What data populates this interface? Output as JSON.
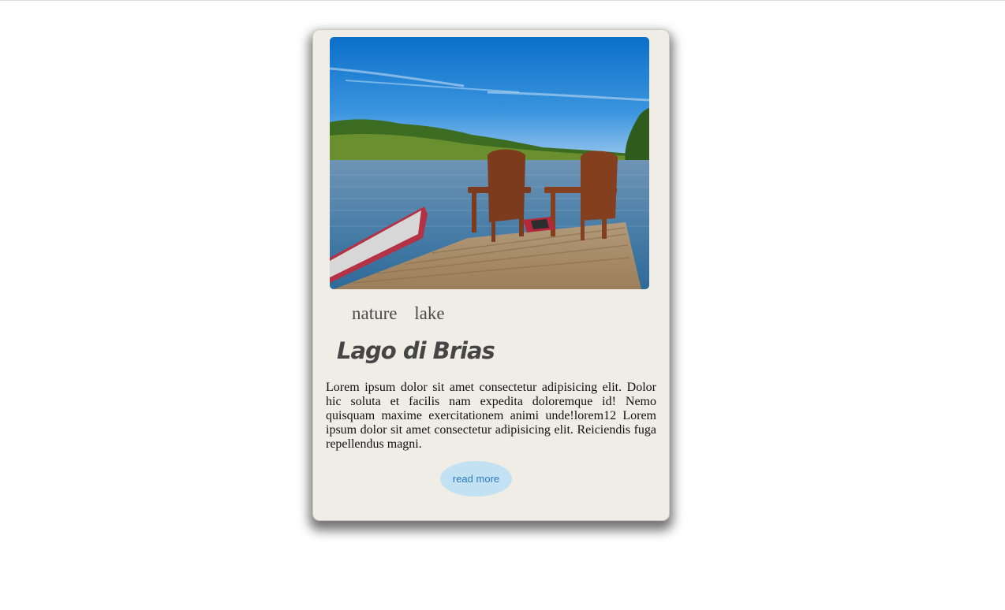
{
  "card": {
    "image_alt": "Two wooden Adirondack chairs on a dock by a lake with a red canoe",
    "tags": [
      "nature",
      "lake"
    ],
    "title": "Lago di Brias",
    "description": "Lorem ipsum dolor sit amet consectetur adipisicing elit. Dolor hic soluta et facilis nam expedita doloremque id! Nemo quisquam maxime exercitationem animi unde!lorem12 Lorem ipsum dolor sit amet consectetur adipisicing elit. Reiciendis fuga repellendus magni.",
    "button_label": "read more"
  },
  "colors": {
    "card_background": "#f0ece6",
    "title": "#454545",
    "button_background": "#c2e1f3",
    "button_text": "#2e7abf"
  }
}
